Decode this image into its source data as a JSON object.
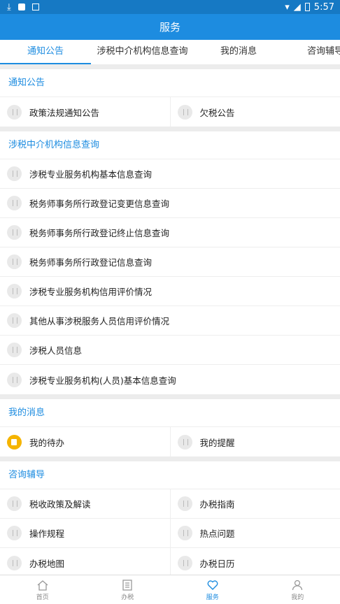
{
  "status_bar": {
    "time": "5:57"
  },
  "header": {
    "title": "服务"
  },
  "tabs": [
    "通知公告",
    "涉税中介机构信息查询",
    "我的消息",
    "咨询辅导"
  ],
  "sections": [
    {
      "title": "通知公告",
      "items": [
        "政策法规通知公告",
        "欠税公告"
      ]
    },
    {
      "title": "涉税中介机构信息查询",
      "items": [
        "涉税专业服务机构基本信息查询",
        "税务师事务所行政登记变更信息查询",
        "税务师事务所行政登记终止信息查询",
        "税务师事务所行政登记信息查询",
        "涉税专业服务机构信用评价情况",
        "其他从事涉税服务人员信用评价情况",
        "涉税人员信息",
        "涉税专业服务机构(人员)基本信息查询"
      ]
    },
    {
      "title": "我的消息",
      "items": [
        "我的待办",
        "我的提醒"
      ]
    },
    {
      "title": "咨询辅导",
      "items": [
        "税收政策及解读",
        "办税指南",
        "操作规程",
        "热点问题",
        "办税地图",
        "办税日历"
      ]
    }
  ],
  "bottom_nav": [
    "首页",
    "办税",
    "服务",
    "我的"
  ],
  "colors": {
    "primary": "#1d8ce0",
    "status_bar": "#1679c4",
    "todo_icon": "#f5b400"
  }
}
